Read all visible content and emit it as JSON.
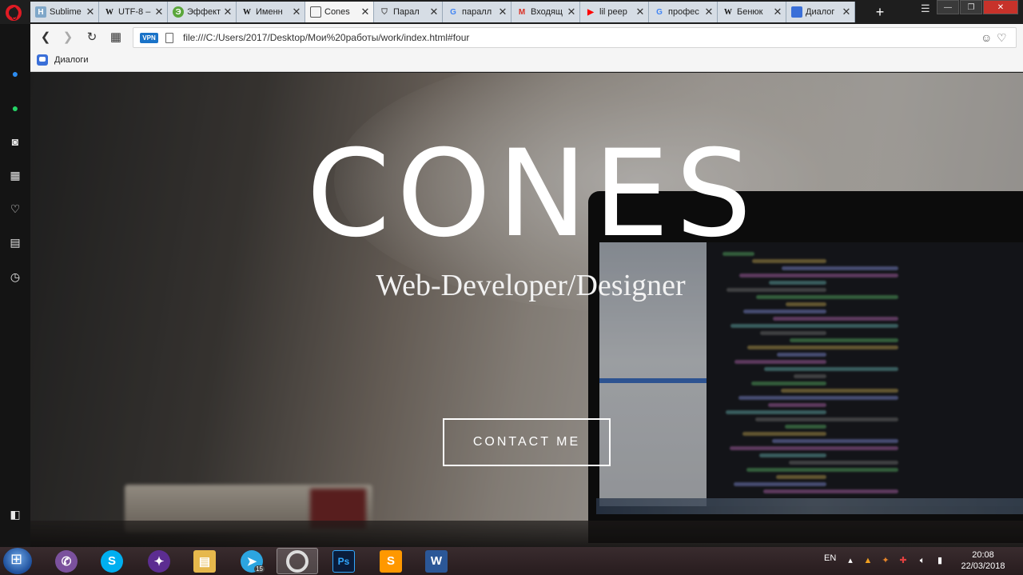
{
  "browser": {
    "tabs": [
      {
        "label": "Sublime",
        "favicon": "H",
        "favicon_color": "#7fa7c9",
        "active": false
      },
      {
        "label": "UTF-8 –",
        "favicon": "W",
        "favicon_color": "#ffffff",
        "active": false
      },
      {
        "label": "Эффект",
        "favicon": "Э",
        "favicon_color": "#5aa63a",
        "active": false
      },
      {
        "label": "Именн",
        "favicon": "W",
        "favicon_color": "#ffffff",
        "active": false
      },
      {
        "label": "Cones",
        "favicon": "file",
        "favicon_color": "#666666",
        "active": true
      },
      {
        "label": "Парал",
        "favicon": "shield",
        "favicon_color": "#555555",
        "active": false
      },
      {
        "label": "паралл",
        "favicon": "G",
        "favicon_color": "#4285f4",
        "active": false
      },
      {
        "label": "Входящ",
        "favicon": "M",
        "favicon_color": "#d93025",
        "active": false
      },
      {
        "label": "lil peep",
        "favicon": "▶",
        "favicon_color": "#ff0000",
        "active": false
      },
      {
        "label": "профес",
        "favicon": "G",
        "favicon_color": "#4285f4",
        "active": false
      },
      {
        "label": "Бенюк",
        "favicon": "W",
        "favicon_color": "#ffffff",
        "active": false
      },
      {
        "label": "Диалог",
        "favicon": "chat",
        "favicon_color": "#3a6fd8",
        "active": false
      }
    ],
    "new_tab_symbol": "+",
    "address": {
      "vpn": "VPN",
      "url": "file:///C:/Users/2017/Desktop/Мои%20работы/work/index.html#four"
    },
    "bookmarks": [
      {
        "label": "Диалоги"
      }
    ]
  },
  "page": {
    "title": "CONES",
    "subtitle": "Web-Developer/Designer",
    "cta": "CONTACT ME"
  },
  "taskbar": {
    "apps": [
      {
        "name": "viber",
        "glyph": "✆",
        "color": "#7b519d"
      },
      {
        "name": "skype",
        "glyph": "S",
        "color": "#00aff0"
      },
      {
        "name": "visual-studio",
        "glyph": "✦",
        "color": "#5c2d91"
      },
      {
        "name": "file-explorer",
        "glyph": "▤",
        "color": "#e6b84c"
      },
      {
        "name": "telegram",
        "glyph": "➤",
        "color": "#2ca5e0",
        "badge": "15"
      },
      {
        "name": "opera",
        "glyph": "O",
        "color": "#9a9a9a"
      },
      {
        "name": "photoshop",
        "glyph": "Ps",
        "color": "#0a1c3a"
      },
      {
        "name": "sublime-text",
        "glyph": "S",
        "color": "#ff9800"
      },
      {
        "name": "word",
        "glyph": "W",
        "color": "#2b5797"
      }
    ],
    "language": "EN",
    "time": "20:08",
    "date": "22/03/2018"
  }
}
